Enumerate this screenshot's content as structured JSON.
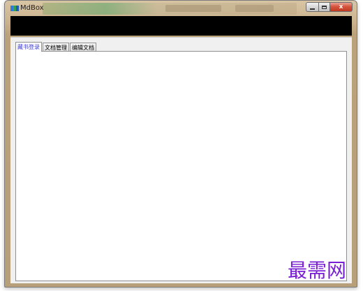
{
  "window": {
    "title": "MdBox",
    "controls": {
      "minimize": "minimize",
      "maximize": "maximize",
      "close": "x"
    }
  },
  "tabs": [
    {
      "label": "藏书登录",
      "active": true
    },
    {
      "label": "文档管理",
      "active": false
    },
    {
      "label": "编辑文档",
      "active": false
    }
  ],
  "watermark": "最需网",
  "colors": {
    "active_tab_text": "#3c3cd0",
    "watermark": "#7a1fd4",
    "band": "#000000"
  }
}
